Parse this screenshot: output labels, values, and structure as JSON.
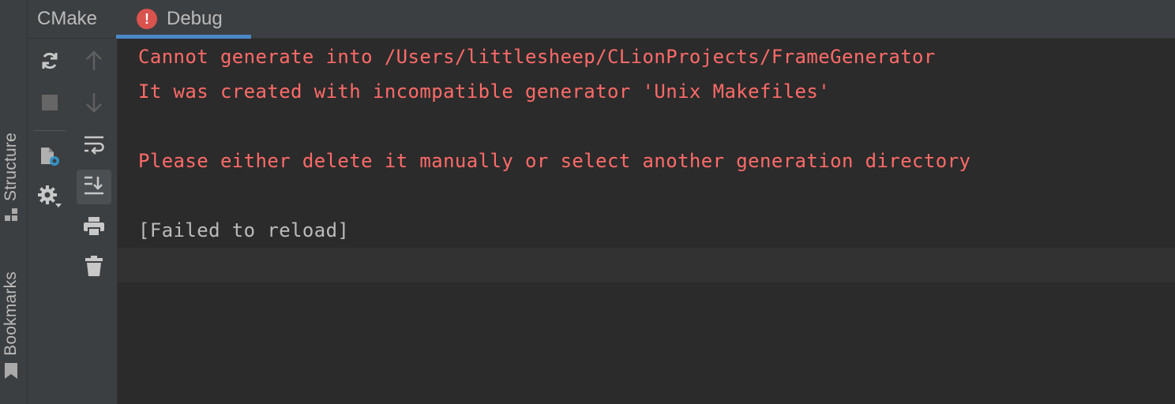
{
  "side_tabs": {
    "structure_label": "Structure",
    "bookmarks_label": "Bookmarks"
  },
  "tabs": {
    "cmake_label": "CMake",
    "debug_label": "Debug",
    "debug_badge": "!"
  },
  "toolbar": {
    "left_icons": [
      "reload-icon",
      "stop-icon",
      "cmake-settings-icon",
      "gear-icon"
    ],
    "right_icons": [
      "arrow-up-icon",
      "arrow-down-icon",
      "soft-wrap-icon",
      "scroll-to-end-icon",
      "print-icon",
      "trash-icon"
    ]
  },
  "console": {
    "lines": [
      "Cannot generate into /Users/littlesheep/CLionProjects/FrameGenerator",
      "It was created with incompatible generator 'Unix Makefiles'",
      "Please either delete it manually or select another generation directory",
      "[Failed to reload]"
    ]
  },
  "colors": {
    "error_text": "#ff6b68",
    "normal_text": "#bbbbbb",
    "accent": "#4a88c7",
    "badge": "#d9534f"
  }
}
